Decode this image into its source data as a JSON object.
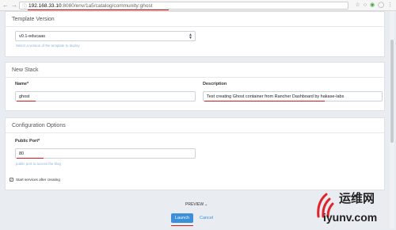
{
  "browser": {
    "url_host": "192.168.33.10",
    "url_path": ":8080/env/1a5/catalog/community:ghost"
  },
  "template_version": {
    "title": "Template Version",
    "selected": "v0.1-educaas",
    "help": "Select a version of the template to deploy"
  },
  "new_stack": {
    "title": "New Stack",
    "name_label": "Name*",
    "name_value": "ghost",
    "description_label": "Description",
    "description_value": "Test creating Ghost container from Rancher Dashboard by hakase-labs"
  },
  "config": {
    "title": "Configuration Options",
    "port_label": "Public Port*",
    "port_value": "80",
    "port_help": "public port to access the blog"
  },
  "start_services_label": "Start services after creating",
  "preview_label": "PREVIEW",
  "launch_label": "Launch",
  "cancel_label": "Cancel",
  "watermark": {
    "brand_cn": "运维网",
    "site": "iyunv.com"
  },
  "colors": {
    "accent": "#3c8fd9",
    "annotation_red": "#d41d1d"
  }
}
